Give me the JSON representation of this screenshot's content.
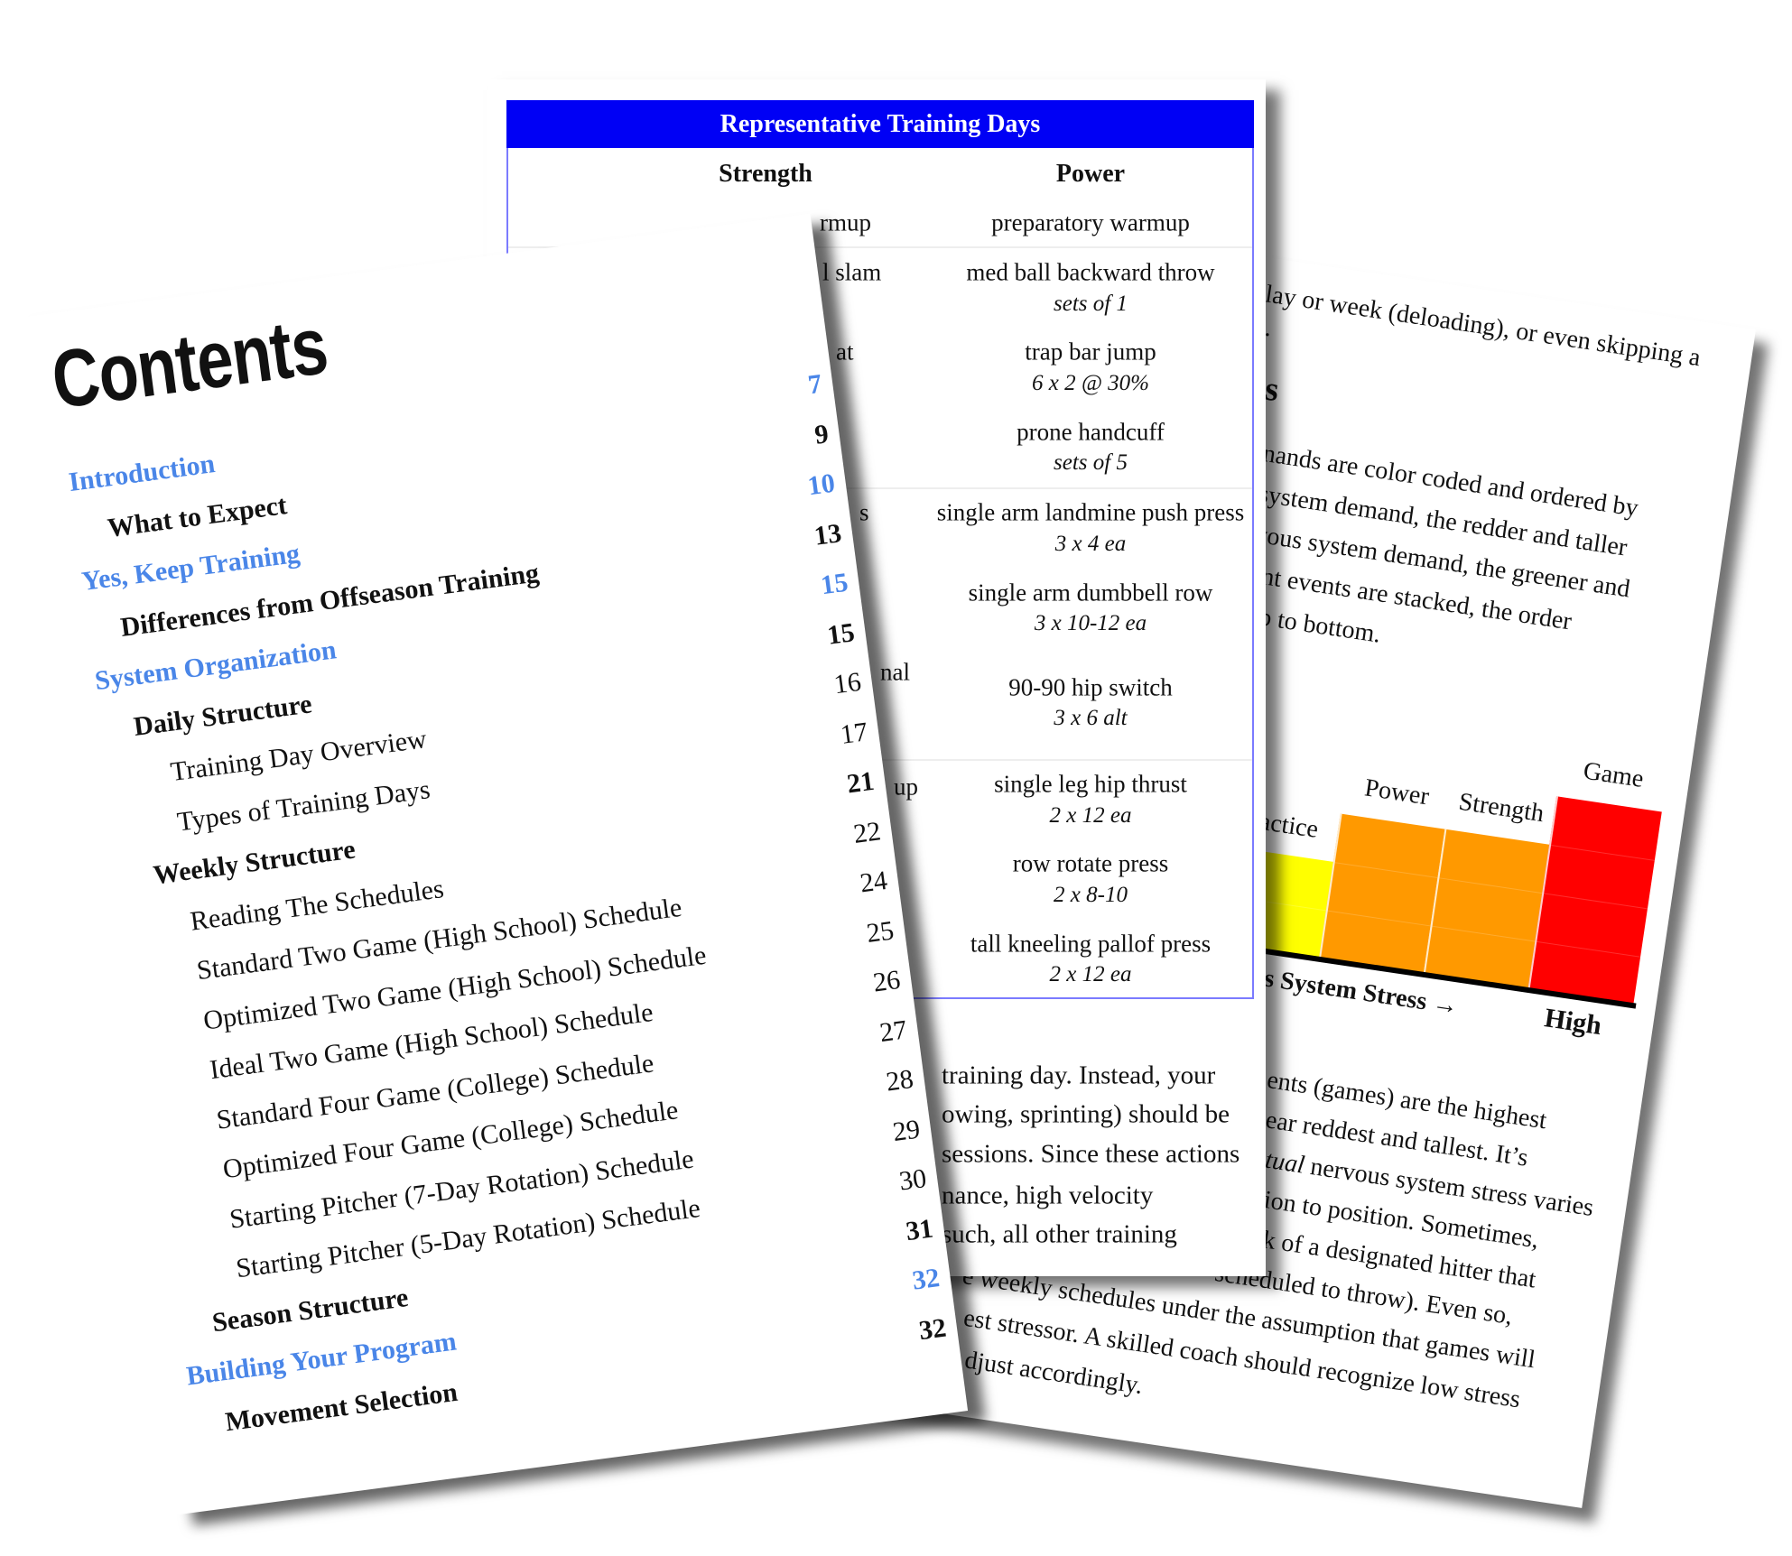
{
  "right_page": {
    "lines_top": [
      "lay or week (deloading), or even skipping a",
      "."
    ],
    "heading_fragment": "s",
    "paragraph_1": [
      "nands are color coded and ordered by",
      "system demand, the redder and taller",
      "vous system demand, the greener and",
      "ent events are stacked, the order",
      "op to bottom."
    ],
    "paragraph_2": [
      "ents (games) are the highest",
      "ear reddest and tallest.  It’s",
      "tual",
      " nervous system stress varies",
      "ion to position.  Sometimes,",
      "k of a designated hitter that",
      "scheduled to throw).  Even so,",
      "e weekly schedules under the assumption that games will",
      "est stressor.  A skilled coach should recognize low stress",
      "djust accordingly."
    ]
  },
  "chart_data": {
    "type": "bar",
    "categories": [
      "Practice",
      "Power",
      "Strength",
      "Game"
    ],
    "values": [
      2,
      3,
      3,
      4
    ],
    "colors": [
      "#ffff00",
      "#ff9900",
      "#ff9900",
      "#ff0000"
    ],
    "xlabel": "Nervous System Stress →",
    "x_end_label": "High",
    "title": "",
    "ylabel": ""
  },
  "table": {
    "title": "Representative Training Days",
    "columns": [
      "Strength",
      "Power"
    ],
    "strength_fragments": [
      "rmup",
      "l slam",
      "at",
      "s",
      "nal",
      "up"
    ],
    "power_rows": [
      {
        "exercise": "preparatory warmup",
        "prescription": ""
      },
      {
        "exercise": "med ball backward throw",
        "prescription": "sets of 1"
      },
      {
        "exercise": "trap bar jump",
        "prescription": "6 x 2 @ 30%"
      },
      {
        "exercise": "prone handcuff",
        "prescription": "sets of 5"
      },
      {
        "exercise": "single arm landmine push press",
        "prescription": "3 x 4 ea"
      },
      {
        "exercise": "single arm dumbbell row",
        "prescription": "3 x 10-12 ea"
      },
      {
        "exercise": "90-90 hip switch",
        "prescription": "3 x 6 alt"
      },
      {
        "exercise": "single leg hip thrust",
        "prescription": "2 x 12 ea"
      },
      {
        "exercise": "row rotate press",
        "prescription": "2 x 8-10"
      },
      {
        "exercise": "tall kneeling pallof press",
        "prescription": "2 x 12 ea"
      }
    ]
  },
  "middle_paragraph": [
    "training day.  Instead, your",
    "owing, sprinting) should be",
    "sessions.  Since these actions",
    "nance, high velocity",
    "such, all other training"
  ],
  "contents": {
    "title": "Contents",
    "link_color": "#4a86e8",
    "entries": [
      {
        "label": "Introduction",
        "page": "7",
        "level": 1
      },
      {
        "label": "What to Expect",
        "page": "9",
        "level": 2
      },
      {
        "label": "Yes, Keep Training",
        "page": "10",
        "level": 1
      },
      {
        "label": "Differences from Offseason Training",
        "page": "13",
        "level": 2
      },
      {
        "label": "System Organization",
        "page": "15",
        "level": 1
      },
      {
        "label": "Daily Structure",
        "page": "15",
        "level": 2
      },
      {
        "label": "Training Day Overview",
        "page": "16",
        "level": 3
      },
      {
        "label": "Types of Training Days",
        "page": "17",
        "level": 3
      },
      {
        "label": "Weekly Structure",
        "page": "21",
        "level": 2
      },
      {
        "label": "Reading The Schedules",
        "page": "22",
        "level": 3
      },
      {
        "label": "Standard Two Game (High School) Schedule",
        "page": "24",
        "level": 3
      },
      {
        "label": "Optimized Two Game (High School) Schedule",
        "page": "25",
        "level": 3
      },
      {
        "label": "Ideal Two Game (High School) Schedule",
        "page": "26",
        "level": 3
      },
      {
        "label": "Standard Four Game (College) Schedule",
        "page": "27",
        "level": 3
      },
      {
        "label": "Optimized Four Game (College) Schedule",
        "page": "28",
        "level": 3
      },
      {
        "label": "Starting Pitcher (7-Day Rotation) Schedule",
        "page": "29",
        "level": 3
      },
      {
        "label": "Starting Pitcher (5-Day Rotation) Schedule",
        "page": "30",
        "level": 3
      },
      {
        "label": "Season Structure",
        "page": "31",
        "level": 2
      },
      {
        "label": "Building Your Program",
        "page": "32",
        "level": 1
      },
      {
        "label": "Movement Selection",
        "page": "32",
        "level": 2
      }
    ]
  }
}
